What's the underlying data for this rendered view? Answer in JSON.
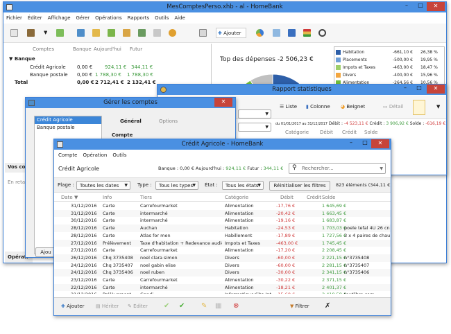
{
  "main": {
    "title": "MesComptesPerso.xhb - al - HomeBank",
    "menu": [
      "Fichier",
      "Éditer",
      "Affichage",
      "Gérer",
      "Opérations",
      "Rapports",
      "Outils",
      "Aide"
    ],
    "add_label": "Ajouter",
    "accounts_headers": [
      "Comptes",
      "Banque",
      "Aujourd'hui",
      "Futur"
    ],
    "group": "Banque",
    "accounts": [
      {
        "name": "Crédit Agricole",
        "bank": "0,00 €",
        "today": "924,11 €",
        "future": "344,11 €"
      },
      {
        "name": "Banque postale",
        "bank": "0,00 €",
        "today": "1 788,30 €",
        "future": "1 788,30 €"
      },
      {
        "name": "Total",
        "bank": "0,00 €",
        "today": "2 712,41 €",
        "future": "2 132,41 €"
      }
    ],
    "side_vos": "Vos com",
    "side_en": "En reta",
    "side_oper": "Opérati",
    "spend_title": "Top des dépenses -2 506,23 €",
    "legend": [
      {
        "color": "#2e5fa8",
        "label": "Habitation",
        "amount": "-661,10 €",
        "pct": "26,38 %"
      },
      {
        "color": "#6f9fd8",
        "label": "Placements",
        "amount": "-500,00 €",
        "pct": "19,95 %"
      },
      {
        "color": "#9ecf6a",
        "label": "Impots et Taxes",
        "amount": "-463,00 €",
        "pct": "18,47 %"
      },
      {
        "color": "#f3a640",
        "label": "Divers",
        "amount": "-400,00 €",
        "pct": "15,96 %"
      },
      {
        "color": "#6fbd3d",
        "label": "Alimentation",
        "amount": "-264,56 €",
        "pct": "10,56 %"
      }
    ],
    "pie_shares": [
      26.38,
      19.95,
      18.47,
      15.96,
      10.56,
      8.68
    ]
  },
  "report": {
    "title": "Rapport statistiques",
    "tb": [
      "Liste",
      "Colonne",
      "Beignet",
      "Détail"
    ],
    "period": "du 01/01/2017 au 31/12/2017",
    "debit_l": "Débit :",
    "debit": "-4 523,11 €",
    "credit_l": "Crédit :",
    "credit": "3 906,92 €",
    "solde_l": "Solde :",
    "solde": "-616,19 €",
    "cols": [
      "Catégorie",
      "Débit",
      "Crédit",
      "Solde"
    ]
  },
  "manage": {
    "title": "Gérer les comptes",
    "list": [
      "Crédit Agricole",
      "Banque postale"
    ],
    "tabs": [
      "Général",
      "Options"
    ],
    "section": "Compte",
    "add": "Ajou"
  },
  "ledger": {
    "title": "Crédit Agricole - HomeBank",
    "menu": [
      "Compte",
      "Opération",
      "Outils"
    ],
    "account": "Crédit Agricole",
    "bank_l": "Banque :",
    "bank": "0,00 €",
    "today_l": "Aujourd'hui :",
    "today": "924,11 €",
    "future_l": "Futur :",
    "future": "344,11 €",
    "search_ph": "Rechercher...",
    "filters": {
      "plage_l": "Plage :",
      "plage": "Toutes les dates",
      "type_l": "Type :",
      "type": "Tous les types",
      "etat_l": "État :",
      "etat": "Tous les états",
      "reset": "Réinitialiser les filtres",
      "count": "823 éléments (344,11 €)"
    },
    "cols": [
      "Date ▼",
      "Info",
      "Tiers",
      "Catégorie",
      "Débit",
      "Crédit",
      "Solde"
    ],
    "rows": [
      [
        "31/12/2016",
        "Carte",
        "Carrefourmarket",
        "Alimentation",
        "-17,76 €",
        "",
        "1 645,69 €",
        ""
      ],
      [
        "31/12/2016",
        "Carte",
        "intermarché",
        "Alimentation",
        "-20,42 €",
        "",
        "1 663,45 €",
        ""
      ],
      [
        "30/12/2016",
        "Carte",
        "intermarché",
        "Alimentation",
        "-19,16 €",
        "",
        "1 683,87 €",
        ""
      ],
      [
        "28/12/2016",
        "Carte",
        "Auchan",
        "Habitation",
        "-24,53 €",
        "",
        "1 703,03 €",
        "poele tefal 4U 26 cn"
      ],
      [
        "28/12/2016",
        "Carte",
        "Atlas for men",
        "Habillement",
        "-17,89 €",
        "",
        "1 727,56 €",
        "3 x 4 paires de chau"
      ],
      [
        "27/12/2016",
        "Prélèvement",
        "Taxe d'habitation + Redevance audio-vi",
        "Impots et Taxes",
        "-463,00 €",
        "",
        "1 745,45 €",
        ""
      ],
      [
        "27/12/2016",
        "Carte",
        "Carrefourmarket",
        "Alimentation",
        "-17,20 €",
        "",
        "2 208,45 €",
        ""
      ],
      [
        "26/12/2016",
        "Chq 3735408",
        "noel clara simon",
        "Divers",
        "-60,00 €",
        "",
        "2 221,15 €",
        "n°3735408"
      ],
      [
        "24/12/2016",
        "Chq 3735407",
        "noel gabin elise",
        "Divers",
        "-60,00 €",
        "",
        "2 281,15 €",
        "n°3735407"
      ],
      [
        "24/12/2016",
        "Chq 3735406",
        "noel ruben",
        "Divers",
        "-30,00 €",
        "",
        "2 341,15 €",
        "n°3735406"
      ],
      [
        "23/12/2016",
        "Carte",
        "Carrefourmarket",
        "Alimentation",
        "-30,22 €",
        "",
        "2 371,15 €",
        ""
      ],
      [
        "22/12/2016",
        "Carte",
        "intermarché",
        "Alimentation",
        "-18,21 €",
        "",
        "2 401,37 €",
        ""
      ],
      [
        "21/12/2016",
        "Prélèvement",
        "Gandi",
        "Informatique:Site Int",
        "-15,60 €",
        "",
        "2 419,58 €",
        "toutlibre.com"
      ]
    ],
    "bottom": [
      "Ajouter",
      "Hériter",
      "Éditer",
      "Filtrer"
    ]
  }
}
